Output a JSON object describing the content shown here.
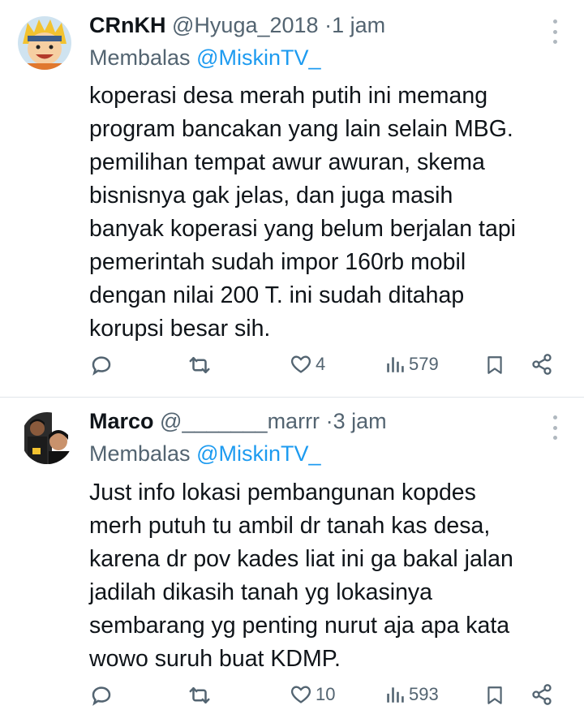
{
  "tweets": [
    {
      "display_name": "CRnKH",
      "handle": "@Hyuga_2018",
      "time": "1 jam",
      "reply_prefix": "Membalas",
      "reply_to": "@MiskinTV_",
      "lines": [
        "koperasi desa merah putih ini memang",
        "program bancakan yang lain selain MBG.",
        "pemilihan tempat awur awuran, skema",
        "bisnisnya gak jelas, dan juga masih",
        "banyak koperasi yang belum berjalan tapi",
        "pemerintah sudah impor 160rb mobil",
        "dengan nilai 200 T. ini sudah ditahap",
        "korupsi besar sih."
      ],
      "likes": "4",
      "views": "579"
    },
    {
      "display_name": "Marco",
      "handle": "@_______marrr",
      "time": "3 jam",
      "reply_prefix": "Membalas",
      "reply_to": "@MiskinTV_",
      "lines": [
        "Just info lokasi pembangunan kopdes",
        "merh putuh tu ambil dr tanah kas desa,",
        "karena dr pov kades liat ini ga bakal jalan",
        "jadilah dikasih tanah yg lokasinya",
        "sembarang yg penting nurut aja apa kata",
        "wowo suruh buat KDMP."
      ],
      "likes": "10",
      "views": "593"
    }
  ],
  "separator": "·",
  "colors": {
    "text": "#0f1419",
    "secondary": "#536471",
    "accent": "#1d9bf0",
    "divider": "#e1e6ea"
  },
  "icons": [
    "reply-icon",
    "retweet-icon",
    "like-icon",
    "views-icon",
    "bookmark-icon",
    "share-icon",
    "more-icon"
  ]
}
